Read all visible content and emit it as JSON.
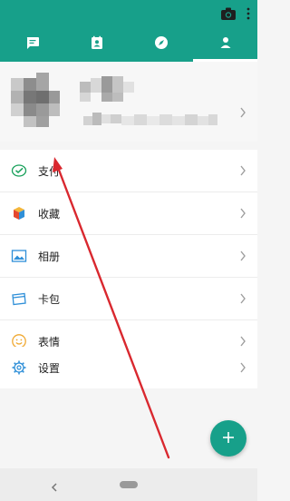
{
  "colors": {
    "accent": "#17a08a",
    "annotation_arrow": "#d9282f"
  },
  "header": {
    "actions": [
      {
        "name": "camera-icon"
      },
      {
        "name": "more-vert-icon"
      }
    ],
    "tabs": [
      {
        "name": "tab-chats",
        "icon": "chat-bubble-icon"
      },
      {
        "name": "tab-contacts",
        "icon": "contacts-book-icon"
      },
      {
        "name": "tab-discover",
        "icon": "compass-icon"
      },
      {
        "name": "tab-me",
        "icon": "person-icon",
        "active": true
      }
    ]
  },
  "menu": {
    "pay": {
      "label": "支付",
      "icon": "wechat-pay-icon"
    },
    "favorites": {
      "label": "收藏",
      "icon": "favorites-cube-icon"
    },
    "album": {
      "label": "相册",
      "icon": "album-image-icon"
    },
    "cards": {
      "label": "卡包",
      "icon": "card-wallet-icon"
    },
    "stickers": {
      "label": "表情",
      "icon": "smiley-icon"
    },
    "settings": {
      "label": "设置",
      "icon": "gear-icon"
    }
  },
  "fab": {
    "icon": "plus-icon"
  },
  "navbar": {
    "back_icon": "nav-back-icon",
    "home_icon": "nav-home-pill"
  }
}
